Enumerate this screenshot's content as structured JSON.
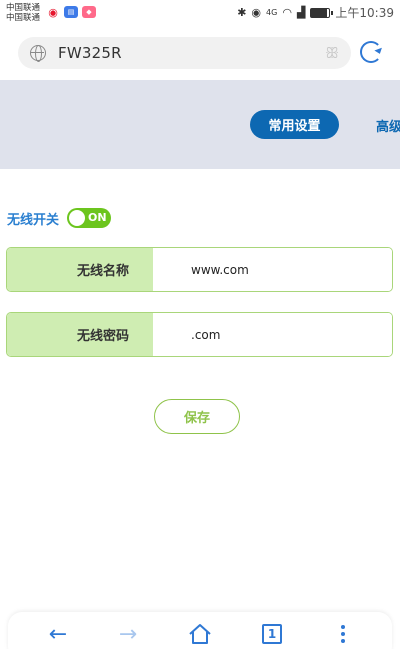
{
  "status_bar": {
    "carrier_1": "中国联通",
    "carrier_2": "中国联通",
    "network": "4G",
    "time": "上午10:39",
    "battery_level": 0.85
  },
  "browser": {
    "url": "FW325R",
    "back_glyph": "←",
    "forward_glyph": "→",
    "tab_count": "1"
  },
  "tabs": {
    "common": "常用设置",
    "advanced": "高级"
  },
  "wireless": {
    "switch_label": "无线开关",
    "switch_state": "ON",
    "ssid_label": "无线名称",
    "ssid_value": "www.com",
    "password_label": "无线密码",
    "password_value": ".com"
  },
  "actions": {
    "save_label": "保存"
  },
  "colors": {
    "accent_blue": "#0d68b2",
    "toggle_green": "#6cc51e",
    "label_green": "#cfedb2",
    "banner_gray": "#dfe2ec"
  }
}
